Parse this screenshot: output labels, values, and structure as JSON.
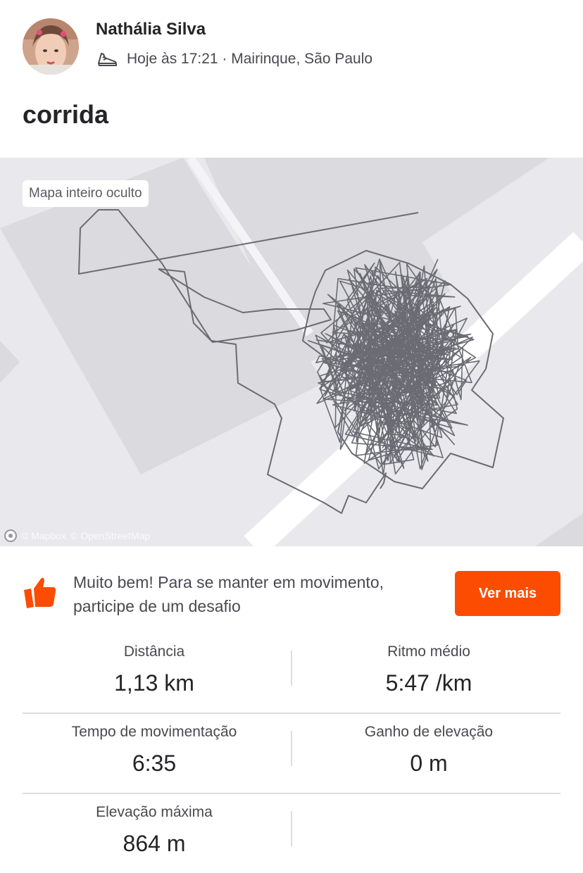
{
  "athlete": {
    "name": "Nathália Silva",
    "meta": "Hoje às 17:21 · Mairinque, São Paulo"
  },
  "activity": {
    "title": "corrida"
  },
  "map": {
    "hidden_label": "Mapa inteiro oculto",
    "attribution_mapbox": "© Mapbox",
    "attribution_osm": "© OpenStreetMap",
    "track_color": "#6b6b73"
  },
  "promo": {
    "text": "Muito bem! Para se manter em movimento, participe de um desafio",
    "button_label": "Ver mais",
    "accent": "#fc4c02"
  },
  "stats": [
    {
      "label": "Distância",
      "value": "1,13 km"
    },
    {
      "label": "Ritmo médio",
      "value": "5:47 /km"
    },
    {
      "label": "Tempo de movimentação",
      "value": "6:35"
    },
    {
      "label": "Ganho de elevação",
      "value": "0 m"
    },
    {
      "label": "Elevação máxima",
      "value": "864 m"
    }
  ]
}
